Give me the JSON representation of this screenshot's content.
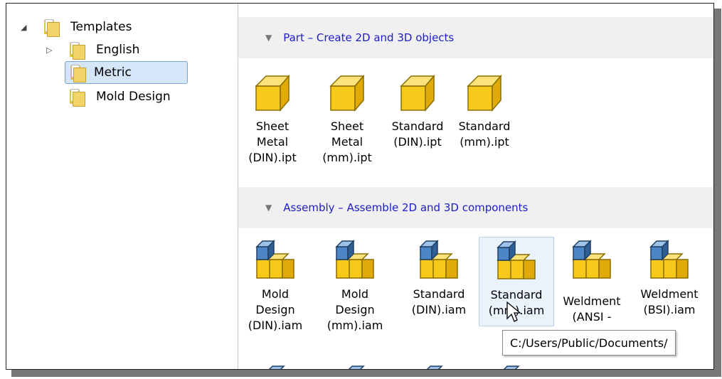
{
  "tree": {
    "root": {
      "label": "Templates",
      "expander": "◢"
    },
    "items": [
      {
        "label": "English",
        "expander": "▷",
        "selected": false
      },
      {
        "label": "Metric",
        "expander": "",
        "selected": true
      },
      {
        "label": "Mold Design",
        "expander": "",
        "selected": false
      }
    ]
  },
  "groups": [
    {
      "header": "Part – Create 2D and 3D objects",
      "files": [
        {
          "caption": "Sheet\nMetal\n(DIN).ipt",
          "icon": "part-cube-icon"
        },
        {
          "caption": "Sheet\nMetal\n(mm).ipt",
          "icon": "part-cube-icon"
        },
        {
          "caption": "Standard\n(DIN).ipt",
          "icon": "part-cube-icon"
        },
        {
          "caption": "Standard\n(mm).ipt",
          "icon": "part-cube-icon"
        }
      ]
    },
    {
      "header": "Assembly – Assemble 2D and 3D components",
      "files": [
        {
          "caption": "Mold\nDesign\n(DIN).iam",
          "icon": "assembly-icon"
        },
        {
          "caption": "Mold\nDesign\n(mm).iam",
          "icon": "assembly-icon"
        },
        {
          "caption": "Standard\n(DIN).iam",
          "icon": "assembly-icon"
        },
        {
          "caption": "Standard\n(mm).iam",
          "icon": "assembly-icon",
          "hovered": true
        },
        {
          "caption": "Weldment\n(ANSI -",
          "icon": "assembly-icon"
        },
        {
          "caption": "Weldment\n(BSI).iam",
          "icon": "assembly-icon"
        }
      ]
    }
  ],
  "tooltip": "C:/Users/Public/Documents/",
  "colors": {
    "header_text": "#1c1cce",
    "cube_yellow": "#f6c91b",
    "cube_blue": "#4d86c4",
    "selection": "#d4e6f7"
  }
}
